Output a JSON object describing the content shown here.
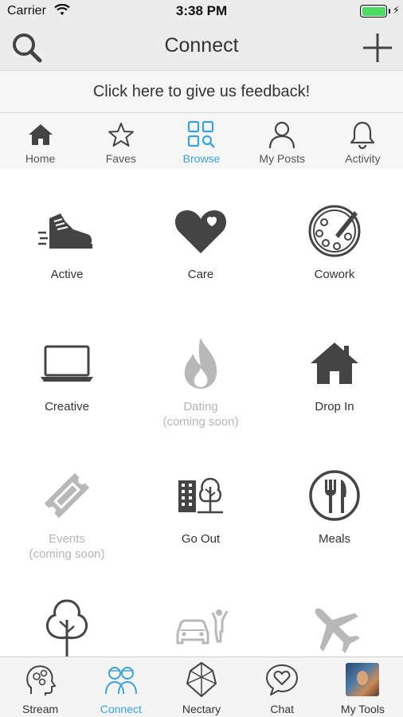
{
  "status_bar": {
    "carrier": "Carrier",
    "time": "3:38 PM"
  },
  "nav": {
    "title": "Connect",
    "left_icon": "search-icon",
    "right_icon": "plus-icon"
  },
  "feedback": {
    "text": "Click here to give us feedback!"
  },
  "top_tabs": [
    {
      "label": "Home",
      "icon": "home-icon",
      "active": false
    },
    {
      "label": "Faves",
      "icon": "star-icon",
      "active": false
    },
    {
      "label": "Browse",
      "icon": "browse-grid-icon",
      "active": true
    },
    {
      "label": "My Posts",
      "icon": "person-icon",
      "active": false
    },
    {
      "label": "Activity",
      "icon": "bell-icon",
      "active": false
    }
  ],
  "categories": [
    {
      "label": "Active",
      "sub": "",
      "icon": "sneaker-icon",
      "disabled": false
    },
    {
      "label": "Care",
      "sub": "",
      "icon": "heart-icon",
      "disabled": false
    },
    {
      "label": "Cowork",
      "sub": "",
      "icon": "palette-icon",
      "disabled": false
    },
    {
      "label": "Creative",
      "sub": "",
      "icon": "laptop-icon",
      "disabled": false
    },
    {
      "label": "Dating",
      "sub": "(coming soon)",
      "icon": "flame-icon",
      "disabled": true
    },
    {
      "label": "Drop In",
      "sub": "",
      "icon": "house-icon",
      "disabled": false
    },
    {
      "label": "Events",
      "sub": "(coming soon)",
      "icon": "ticket-icon",
      "disabled": true
    },
    {
      "label": "Go Out",
      "sub": "",
      "icon": "city-tree-icon",
      "disabled": false
    },
    {
      "label": "Meals",
      "sub": "",
      "icon": "fork-knife-icon",
      "disabled": false
    },
    {
      "label": "",
      "sub": "",
      "icon": "tree-icon",
      "disabled": false
    },
    {
      "label": "",
      "sub": "",
      "icon": "car-person-icon",
      "disabled": true
    },
    {
      "label": "",
      "sub": "",
      "icon": "airplane-icon",
      "disabled": true
    }
  ],
  "bottom_tabs": [
    {
      "label": "Stream",
      "icon": "head-gears-icon",
      "active": false
    },
    {
      "label": "Connect",
      "icon": "people-icon",
      "active": true
    },
    {
      "label": "Nectary",
      "icon": "gem-icon",
      "active": false
    },
    {
      "label": "Chat",
      "icon": "chat-heart-icon",
      "active": false
    },
    {
      "label": "My Tools",
      "icon": "avatar",
      "active": false
    }
  ],
  "colors": {
    "accent": "#3aa3dc",
    "icon_dark": "#444444",
    "icon_disabled": "#b8b8b8"
  }
}
